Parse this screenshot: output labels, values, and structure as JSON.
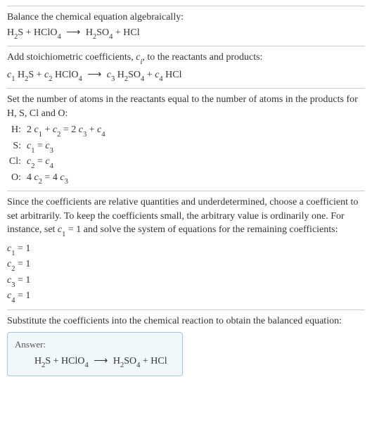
{
  "section1": {
    "title": "Balance the chemical equation algebraically:",
    "eq_lhs1": "H",
    "eq_lhs1_sub": "2",
    "eq_lhs1b": "S + HClO",
    "eq_lhs1b_sub": "4",
    "arrow": "⟶",
    "eq_rhs1": "H",
    "eq_rhs1_sub": "2",
    "eq_rhs1b": "SO",
    "eq_rhs1b_sub": "4",
    "eq_rhs1c": " + HCl"
  },
  "section2": {
    "title_a": "Add stoichiometric coefficients, ",
    "title_ci": "c",
    "title_ci_sub": "i",
    "title_b": ", to the reactants and products:",
    "c1": "c",
    "c1s": "1",
    "sp1a": " H",
    "sp1b": "2",
    "sp1c": "S + ",
    "c2": "c",
    "c2s": "2",
    "sp2a": " HClO",
    "sp2b": "4",
    "arrow": "⟶",
    "c3": "c",
    "c3s": "3",
    "sp3a": " H",
    "sp3b": "2",
    "sp3c": "SO",
    "sp3d": "4",
    "sp3e": " + ",
    "c4": "c",
    "c4s": "4",
    "sp4a": " HCl"
  },
  "section3": {
    "title": "Set the number of atoms in the reactants equal to the number of atoms in the products for H, S, Cl and O:",
    "rows": [
      {
        "label": "H:",
        "lhs_a": "2 ",
        "c1": "c",
        "c1s": "1",
        "plus": " + ",
        "c2": "c",
        "c2s": "2",
        "eq": " = 2 ",
        "c3": "c",
        "c3s": "3",
        "plus2": " + ",
        "c4": "c",
        "c4s": "4"
      },
      {
        "label": "S:",
        "c1": "c",
        "c1s": "1",
        "eq": " = ",
        "c3": "c",
        "c3s": "3"
      },
      {
        "label": "Cl:",
        "c2": "c",
        "c2s": "2",
        "eq": " = ",
        "c4": "c",
        "c4s": "4"
      },
      {
        "label": "O:",
        "lhs_a": "4 ",
        "c2": "c",
        "c2s": "2",
        "eq": " = 4 ",
        "c3": "c",
        "c3s": "3"
      }
    ]
  },
  "section4": {
    "text_a": "Since the coefficients are relative quantities and underdetermined, choose a coefficient to set arbitrarily. To keep the coefficients small, the arbitrary value is ordinarily one. For instance, set ",
    "ci": "c",
    "cis": "1",
    "text_b": " = 1 and solve the system of equations for the remaining coefficients:",
    "coefs": [
      {
        "c": "c",
        "cs": "1",
        "val": " = 1"
      },
      {
        "c": "c",
        "cs": "2",
        "val": " = 1"
      },
      {
        "c": "c",
        "cs": "3",
        "val": " = 1"
      },
      {
        "c": "c",
        "cs": "4",
        "val": " = 1"
      }
    ]
  },
  "section5": {
    "title": "Substitute the coefficients into the chemical reaction to obtain the balanced equation:",
    "answer_label": "Answer:",
    "eq_lhs1": "H",
    "eq_lhs1_sub": "2",
    "eq_lhs1b": "S + HClO",
    "eq_lhs1b_sub": "4",
    "arrow": "⟶",
    "eq_rhs1": "H",
    "eq_rhs1_sub": "2",
    "eq_rhs1b": "SO",
    "eq_rhs1b_sub": "4",
    "eq_rhs1c": " + HCl"
  }
}
